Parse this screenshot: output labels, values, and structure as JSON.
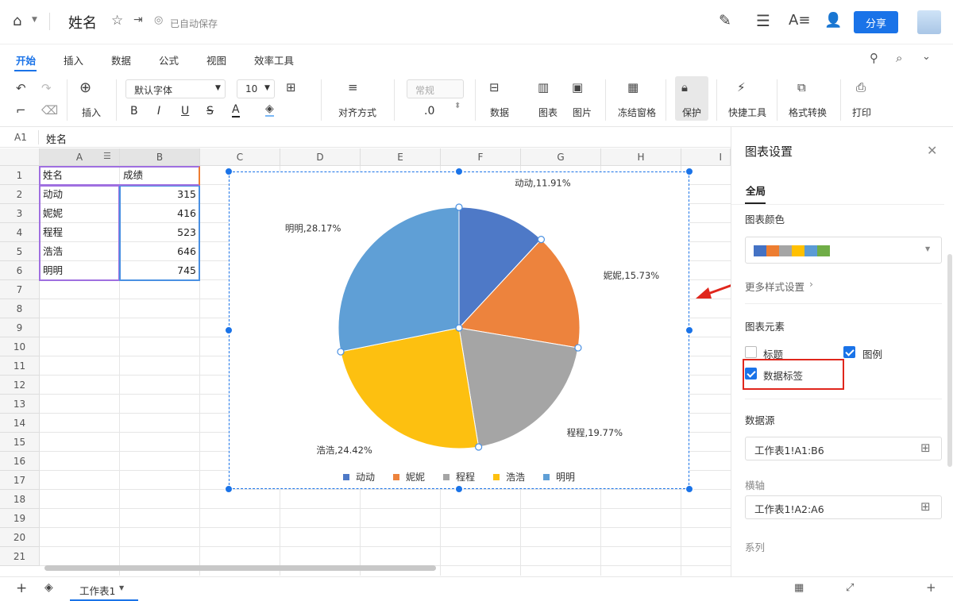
{
  "doc": {
    "title": "姓名",
    "autosave": "已自动保存",
    "share": "分享"
  },
  "tabs": [
    "开始",
    "插入",
    "数据",
    "公式",
    "视图",
    "效率工具"
  ],
  "toolbar": {
    "insert": "插入",
    "font": "默认字体",
    "size": "10",
    "bold": "B",
    "italic": "I",
    "underline": "U",
    "strike": "S",
    "fontcolor": "A",
    "align": "对齐方式",
    "format": "常规",
    "decimal": ".0",
    "data": "数据",
    "chart": "图表",
    "image": "图片",
    "freeze": "冻结窗格",
    "protect": "保护",
    "quick": "快捷工具",
    "convert": "格式转换",
    "print": "打印"
  },
  "formula": {
    "ref": "A1",
    "value": "姓名"
  },
  "columns": [
    "A",
    "B",
    "C",
    "D",
    "E",
    "F",
    "G",
    "H",
    "I"
  ],
  "rows": [
    "1",
    "2",
    "3",
    "4",
    "5",
    "6",
    "7",
    "8",
    "9",
    "10",
    "11",
    "12",
    "13",
    "14",
    "15",
    "16",
    "17",
    "18",
    "19",
    "20",
    "21"
  ],
  "table": {
    "headers": [
      "姓名",
      "成绩"
    ],
    "rows": [
      [
        "动动",
        "315"
      ],
      [
        "妮妮",
        "416"
      ],
      [
        "程程",
        "523"
      ],
      [
        "浩浩",
        "646"
      ],
      [
        "明明",
        "745"
      ]
    ]
  },
  "chart_data": {
    "type": "pie",
    "categories": [
      "动动",
      "妮妮",
      "程程",
      "浩浩",
      "明明"
    ],
    "values": [
      315,
      416,
      523,
      646,
      745
    ],
    "percent_labels": [
      "动动,11.91%",
      "妮妮,15.73%",
      "程程,19.77%",
      "浩浩,24.42%",
      "明明,28.17%"
    ],
    "colors": [
      "#4e79c7",
      "#ed833d",
      "#a5a5a5",
      "#fdc010",
      "#5f9fd6"
    ],
    "legend": "bottom"
  },
  "panel": {
    "title": "图表设置",
    "tab": "全局",
    "color_label": "图表颜色",
    "palette": [
      "#4472c4",
      "#ed7d31",
      "#a5a5a5",
      "#ffc000",
      "#5b9bd5",
      "#70ad47"
    ],
    "more": "更多样式设置",
    "elements_label": "图表元素",
    "chk_title": "标题",
    "chk_title_on": false,
    "chk_legend": "图例",
    "chk_legend_on": true,
    "chk_datalabel": "数据标签",
    "chk_datalabel_on": true,
    "source_label": "数据源",
    "source": "工作表1!A1:B6",
    "axis_label": "横轴",
    "axis": "工作表1!A2:A6",
    "series_label": "系列"
  },
  "sheet": {
    "name": "工作表1"
  }
}
